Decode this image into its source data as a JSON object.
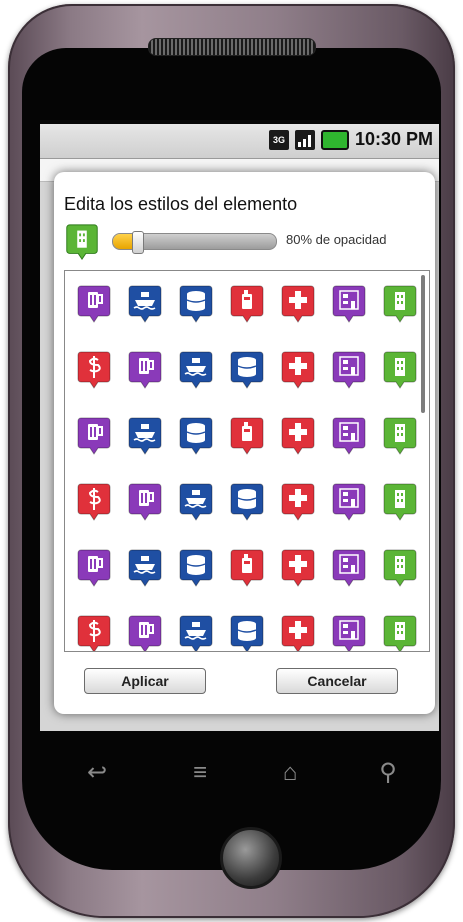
{
  "status_bar": {
    "network_label": "3G",
    "time": "10:30 PM"
  },
  "dialog": {
    "title": "Edita los estilos del elemento",
    "selected_icon": "tower-icon",
    "opacity": {
      "value_percent": 80,
      "label": "80% de opacidad"
    },
    "icon_rows": [
      [
        "beer-icon",
        "ship-icon",
        "barrel-icon",
        "fuel-icon",
        "hospital-icon",
        "building-icon",
        "tower-icon"
      ],
      [
        "pharmacy-icon",
        "beer-icon",
        "ship-icon",
        "barrel-icon",
        "hospital-icon",
        "building-icon",
        "tower-icon"
      ],
      [
        "beer-icon",
        "ship-icon",
        "barrel-icon",
        "fuel-icon",
        "hospital-icon",
        "building-icon",
        "tower-icon"
      ],
      [
        "pharmacy-icon",
        "beer-icon",
        "ship-icon",
        "barrel-icon",
        "hospital-icon",
        "building-icon",
        "tower-icon"
      ],
      [
        "beer-icon",
        "ship-icon",
        "barrel-icon",
        "fuel-icon",
        "hospital-icon",
        "building-icon",
        "tower-icon"
      ],
      [
        "pharmacy-icon",
        "beer-icon",
        "ship-icon",
        "barrel-icon",
        "hospital-icon",
        "building-icon",
        "tower-icon"
      ]
    ],
    "apply_label": "Aplicar",
    "cancel_label": "Cancelar"
  },
  "icon_colors": {
    "beer-icon": "#8a3ab9",
    "ship-icon": "#1f4fa3",
    "barrel-icon": "#1f4fa3",
    "fuel-icon": "#e0313b",
    "hospital-icon": "#e0313b",
    "building-icon": "#8a3ab9",
    "tower-icon": "#5bb536",
    "pharmacy-icon": "#e0313b"
  },
  "nav_keys": [
    "back-icon",
    "menu-icon",
    "home-icon",
    "search-icon"
  ]
}
